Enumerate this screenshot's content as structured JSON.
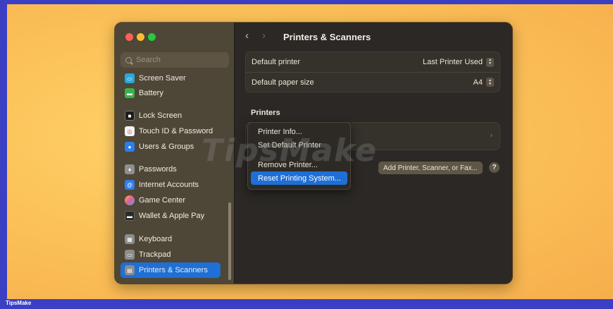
{
  "sidebar": {
    "search_placeholder": "Search",
    "items": [
      {
        "label": "Screen Saver",
        "icon": "screen-saver-icon",
        "color": "#2aa8d8",
        "glyph": "▭"
      },
      {
        "label": "Battery",
        "icon": "battery-icon",
        "color": "#38b34a",
        "glyph": "▬"
      },
      {
        "label": "Lock Screen",
        "icon": "lock-screen-icon",
        "color": "#1c1c1c",
        "glyph": "■"
      },
      {
        "label": "Touch ID & Password",
        "icon": "fingerprint-icon",
        "color": "#f2f2f2",
        "glyph": "◎"
      },
      {
        "label": "Users & Groups",
        "icon": "users-icon",
        "color": "#2c7ef0",
        "glyph": "●"
      },
      {
        "label": "Passwords",
        "icon": "key-icon",
        "color": "#8f8f8f",
        "glyph": "♦"
      },
      {
        "label": "Internet Accounts",
        "icon": "at-icon",
        "color": "#2c7ef0",
        "glyph": "@"
      },
      {
        "label": "Game Center",
        "icon": "game-center-icon",
        "color": "#e45a9a",
        "glyph": "●"
      },
      {
        "label": "Wallet & Apple Pay",
        "icon": "wallet-icon",
        "color": "#2a2a2a",
        "glyph": "▬"
      },
      {
        "label": "Keyboard",
        "icon": "keyboard-icon",
        "color": "#8c8c8c",
        "glyph": "▦"
      },
      {
        "label": "Trackpad",
        "icon": "trackpad-icon",
        "color": "#8c8c8c",
        "glyph": "▭"
      },
      {
        "label": "Printers & Scanners",
        "icon": "printer-icon",
        "color": "#8c8c8c",
        "glyph": "▤",
        "active": true
      }
    ]
  },
  "header": {
    "title": "Printers & Scanners"
  },
  "settings": {
    "default_printer_label": "Default printer",
    "default_printer_value": "Last Printer Used",
    "default_paper_label": "Default paper size",
    "default_paper_value": "A4"
  },
  "printers": {
    "section_title": "Printers",
    "add_button": "Add Printer, Scanner, or Fax...",
    "help_button": "?"
  },
  "context_menu": {
    "items": [
      "Printer Info...",
      "Set Default Printer",
      "Remove Printer...",
      "Reset Printing System..."
    ],
    "highlighted": "Reset Printing System..."
  },
  "watermark": "TipsMake",
  "footer_brand": "TipsMake",
  "colors": {
    "accent": "#1e6fd6",
    "background": "#fcc35a",
    "bottom_bar": "#3b3fc4"
  }
}
